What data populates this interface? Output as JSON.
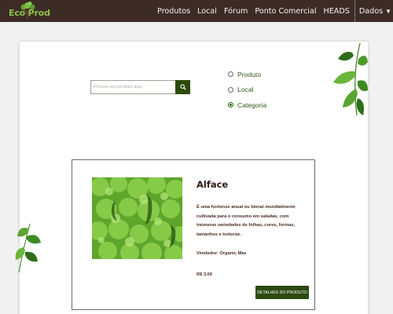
{
  "brand": {
    "logo_text": "Eco Prod",
    "logo_icon": "tree-icon"
  },
  "navbar": {
    "links": [
      "Produtos",
      "Local",
      "Fórum",
      "Ponto Comercial",
      "HEADS"
    ],
    "user_menu": "Dados",
    "user_menu_icon": "caret-down-icon"
  },
  "search": {
    "placeholder": "Procure seu produto aqui",
    "value": "",
    "button_icon": "search-icon"
  },
  "filter": {
    "options": [
      "Produto",
      "Local",
      "Categoria"
    ],
    "selected": "Categoria"
  },
  "product": {
    "name": "Alface",
    "description": "É uma hortense anual ou bienal mundialmente cultivada para o consumo em saladas, com inúmeras variedades de folhas, cores, formas, tamanhos e texturas.",
    "vendor": "Vendedor: Organic Max",
    "price": "R$ 3.00",
    "details_button": "DETALHES DO PRODUTO",
    "image": "lettuce-photo"
  },
  "colors": {
    "navbar_bg": "#3d2c26",
    "brand_green": "#2e4a0b",
    "text_brown": "#4a2e24",
    "radio_label": "#2f5a17",
    "logo_green": "#8bc34a"
  }
}
